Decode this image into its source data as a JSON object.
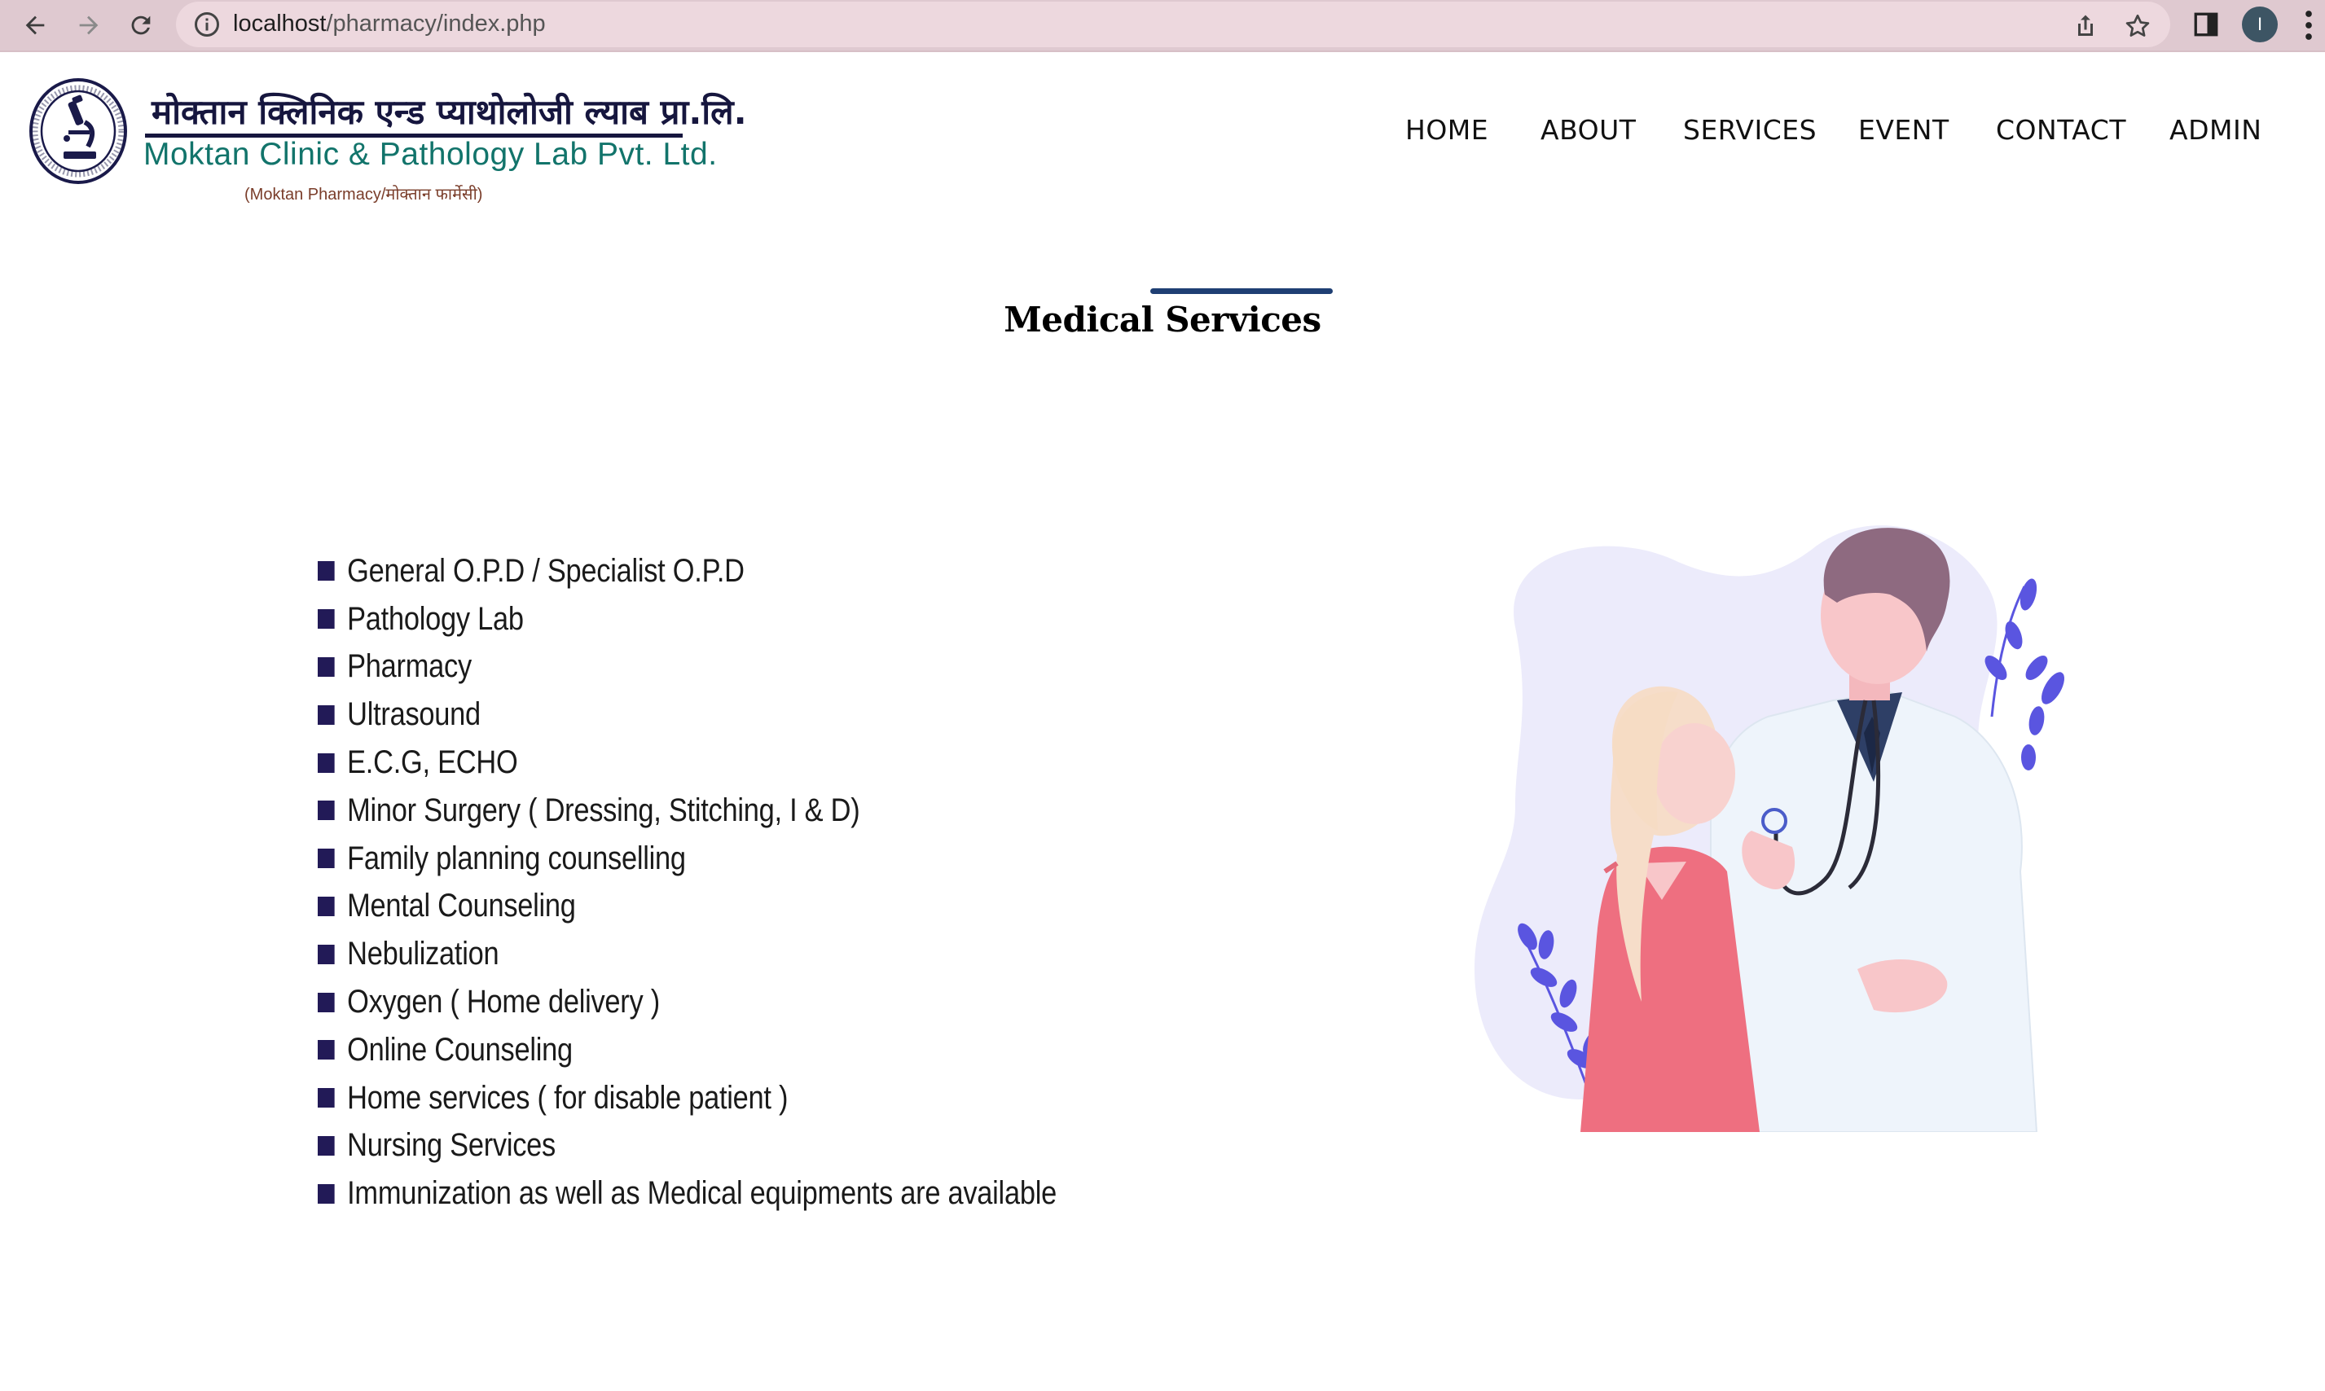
{
  "browser": {
    "url_host": "localhost",
    "url_path": "/pharmacy/index.php",
    "profile_initial": "I",
    "icons": {
      "back": "arrow-left-icon",
      "forward": "arrow-right-icon",
      "reload": "reload-icon",
      "site_info": "info-icon",
      "share": "share-icon",
      "bookmark": "star-icon",
      "side_panel": "side-panel-icon",
      "menu": "kebab-menu-icon"
    }
  },
  "site": {
    "logo_nepali": "मोक्तान क्लिनिक एन्ड प्याथोलोजी ल्याब प्रा.लि.",
    "logo_english": "Moktan Clinic & Pathology Lab Pvt. Ltd.",
    "logo_sub": "(Moktan Pharmacy/मोक्तान फार्मेसी)",
    "brand_color": "#16163e",
    "accent_color": "#12746b"
  },
  "nav": {
    "items": [
      "HOME",
      "ABOUT",
      "SERVICES",
      "EVENT",
      "CONTACT",
      "ADMIN"
    ]
  },
  "section": {
    "title": "Medical Services",
    "bar_color": "#1f3f73"
  },
  "services": {
    "bullet_color": "#221a57",
    "items": [
      "General O.P.D / Specialist O.P.D",
      "Pathology Lab",
      "Pharmacy",
      "Ultrasound",
      "E.C.G, ECHO",
      "Minor Surgery ( Dressing, Stitching, I & D)",
      "Family planning counselling",
      "Mental Counseling",
      "Nebulization",
      "Oxygen ( Home delivery )",
      "Online Counseling",
      "Home services ( for disable patient )",
      "Nursing Services",
      "Immunization as well as Medical equipments are available"
    ]
  }
}
